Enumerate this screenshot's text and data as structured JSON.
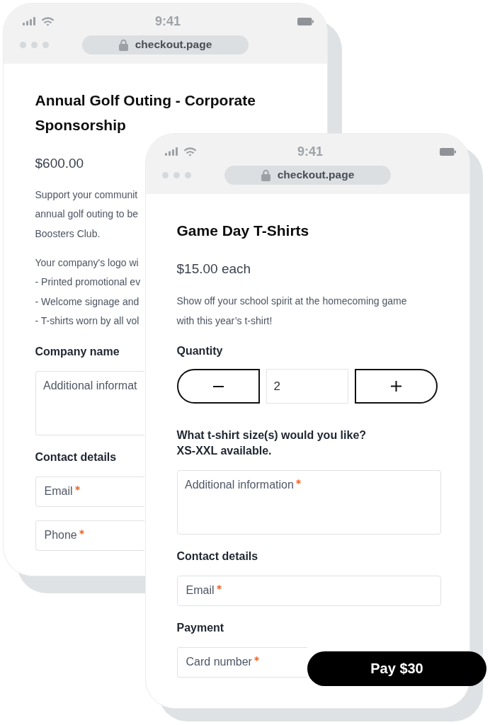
{
  "back_phone": {
    "status_bar": {
      "time": "9:41"
    },
    "address_bar": {
      "url": "checkout.page"
    },
    "title": "Annual Golf Outing - Corporate Sponsorship",
    "price": "$600.00",
    "content": [
      {
        "kind": "lines",
        "lines": [
          "Support your communit",
          "annual golf outing to be",
          "Boosters Club."
        ]
      },
      {
        "kind": "lines",
        "lines": [
          "Your company's logo wi",
          "- Printed promotional ev",
          "- Welcome signage and",
          "- T-shirts worn by all vol"
        ]
      },
      {
        "kind": "heading",
        "text": "Company name"
      },
      {
        "kind": "textarea",
        "placeholder": "Additional informat"
      },
      {
        "kind": "heading",
        "text": "Contact details"
      },
      {
        "kind": "input",
        "placeholder": "Email",
        "required": true
      },
      {
        "kind": "input",
        "placeholder": "Phone",
        "required": true
      }
    ]
  },
  "front_phone": {
    "status_bar": {
      "time": "9:41"
    },
    "address_bar": {
      "url": "checkout.page"
    },
    "title": "Game Day T-Shirts",
    "price": "$15.00 each",
    "content": [
      {
        "kind": "paragraph",
        "text": "Show off your school spirit at the homecoming game with this year’s t-shirt!"
      },
      {
        "kind": "heading",
        "text": "Quantity"
      },
      {
        "kind": "stepper",
        "value": "2"
      },
      {
        "kind": "heading",
        "text": "What t-shirt size(s) would you like?\nXS-XXL available."
      },
      {
        "kind": "textarea",
        "placeholder": "Additional information",
        "required": true
      },
      {
        "kind": "heading",
        "text": "Contact details"
      },
      {
        "kind": "input",
        "placeholder": "Email",
        "required": true
      },
      {
        "kind": "heading",
        "text": "Payment"
      },
      {
        "kind": "input",
        "placeholder": "Card number",
        "required": true
      }
    ],
    "pay_button": {
      "label": "Pay $30"
    }
  }
}
